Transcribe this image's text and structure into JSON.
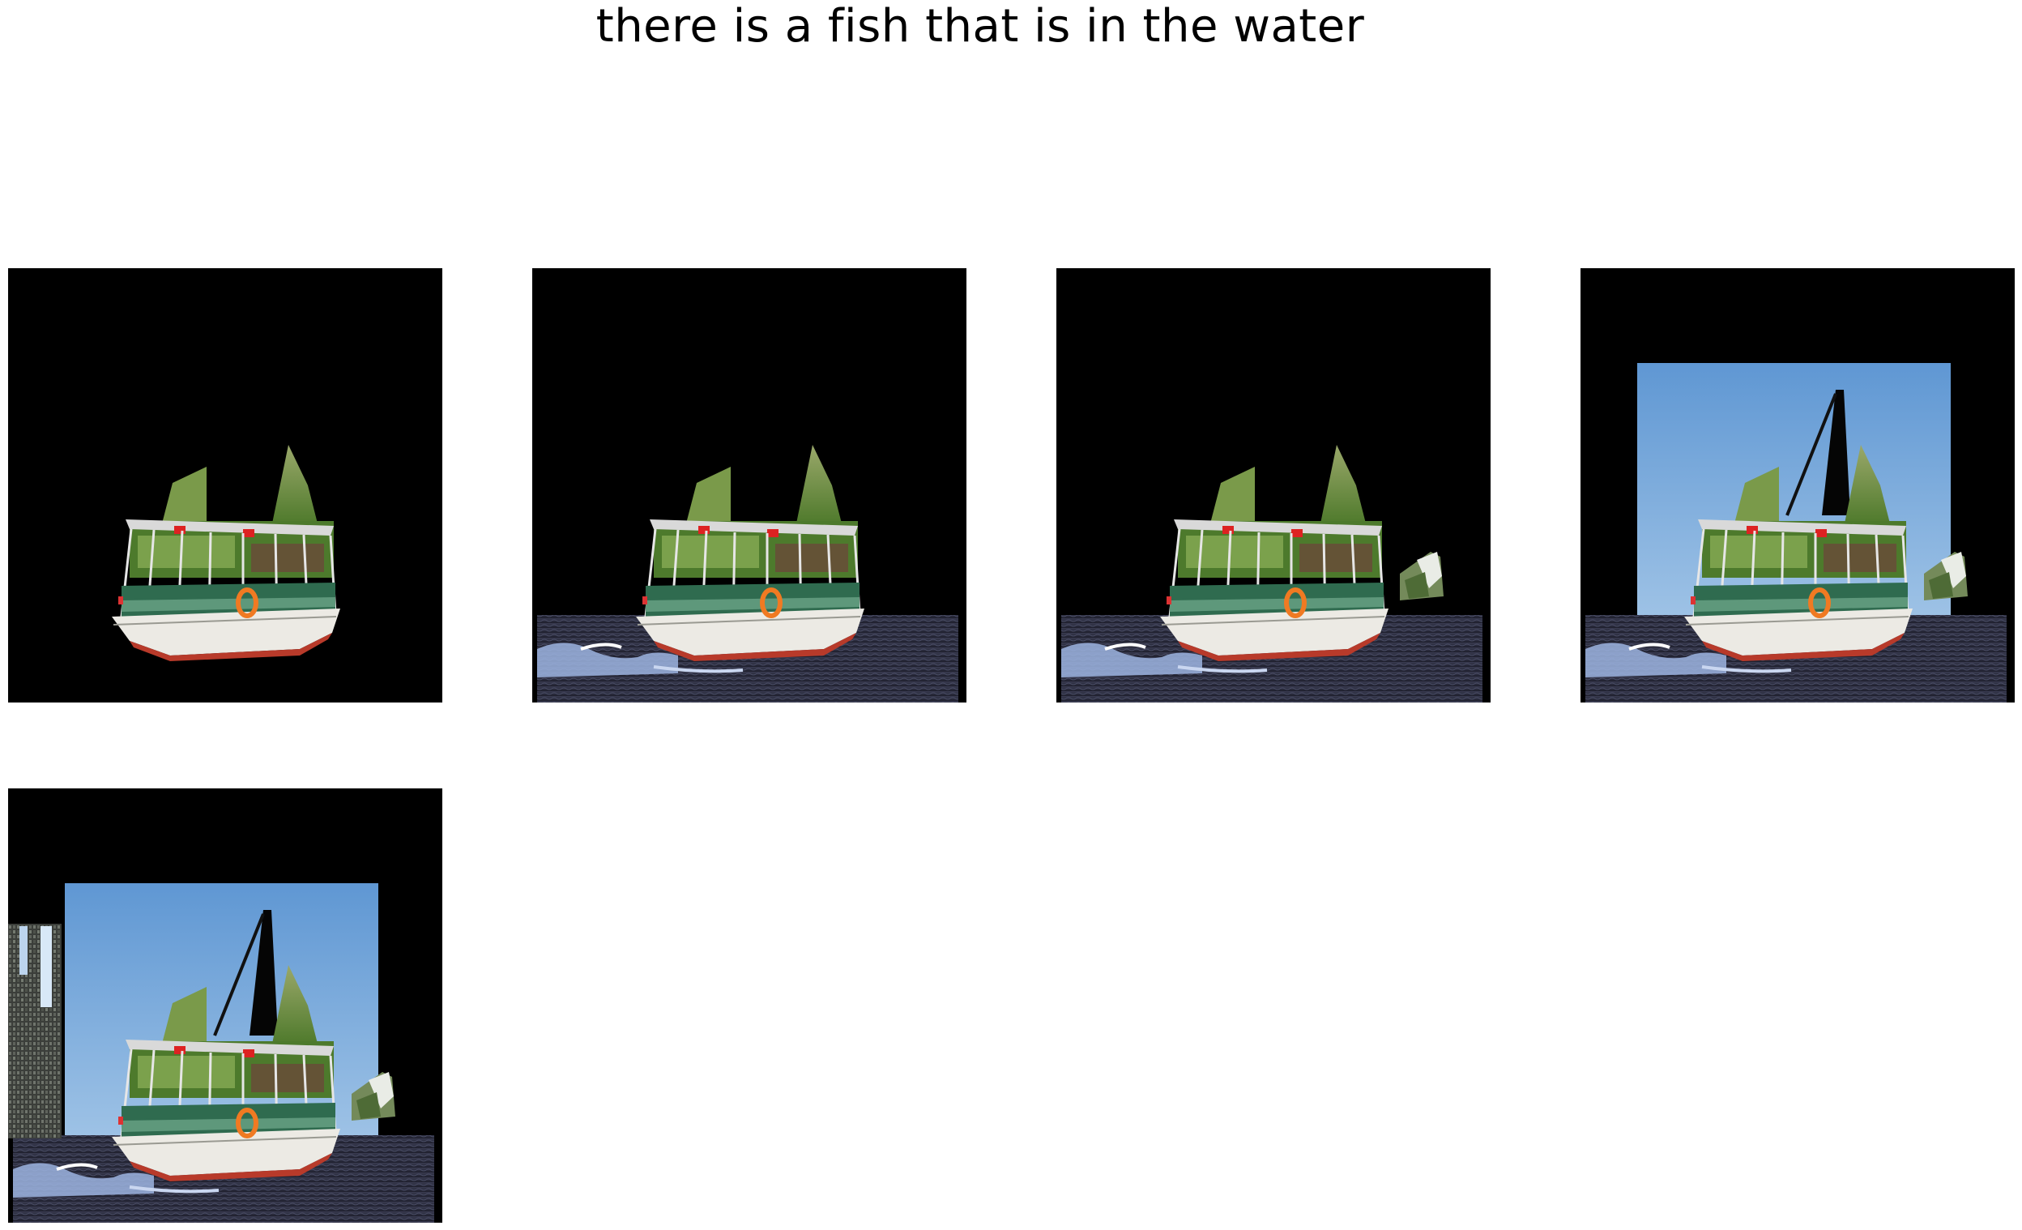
{
  "figure": {
    "title": "there is a fish that is in the water"
  },
  "panels": [
    {
      "id": 1,
      "layers": [
        "boat"
      ]
    },
    {
      "id": 2,
      "layers": [
        "boat",
        "water"
      ]
    },
    {
      "id": 3,
      "layers": [
        "boat",
        "water",
        "foliage-patch"
      ]
    },
    {
      "id": 4,
      "layers": [
        "boat",
        "water",
        "foliage-patch",
        "sky",
        "sail"
      ]
    },
    {
      "id": 5,
      "layers": [
        "boat",
        "water",
        "foliage-patch",
        "sky",
        "sail",
        "building"
      ]
    }
  ],
  "colors": {
    "background": "#000000",
    "sky": "#6fa3d8",
    "water": "#2f3142",
    "foam": "#9cb4e0",
    "foliage": "#5f8f3a",
    "hull": "#e8e6df",
    "hull_stripe": "#3a8f6f",
    "life_ring": "#f07a22",
    "roof_rail": "#c8c8c8"
  }
}
